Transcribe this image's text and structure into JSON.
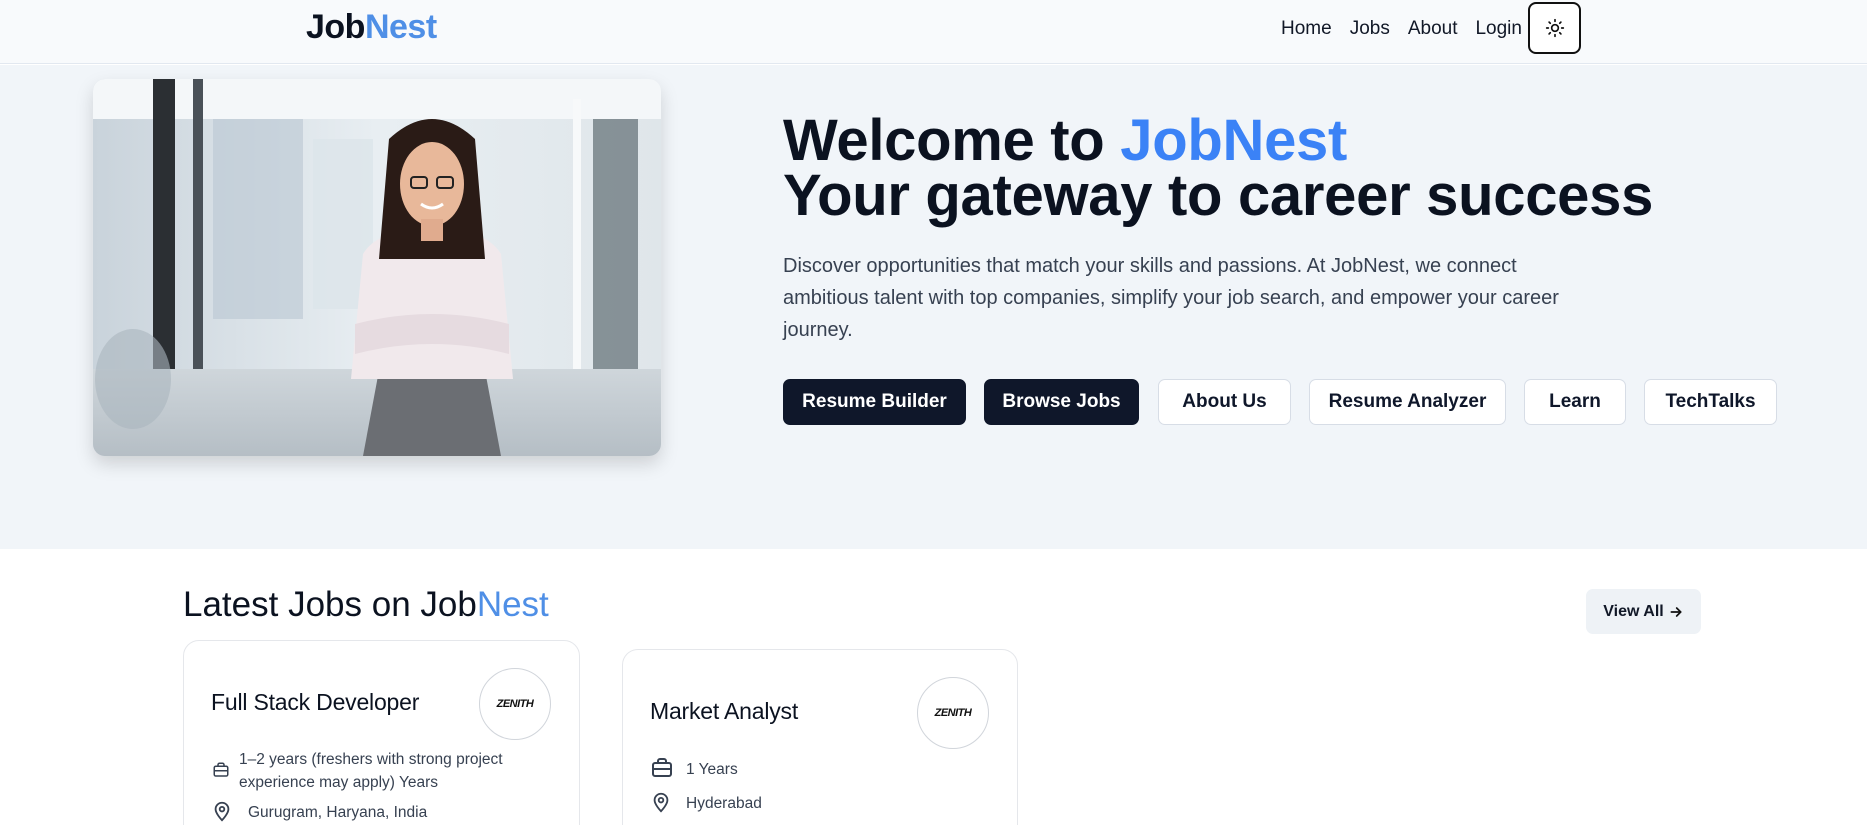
{
  "nav": {
    "logo_part1": "Job",
    "logo_part2": "Nest",
    "links": [
      "Home",
      "Jobs",
      "About",
      "Login"
    ],
    "theme_icon": "sun-icon"
  },
  "hero": {
    "title_prefix": "Welcome to ",
    "title_highlight": "JobNest",
    "title_line2": "Your gateway to career success",
    "description": "Discover opportunities that match your skills and passions. At JobNest, we connect ambitious talent with top companies, simplify your job search, and empower your career journey.",
    "buttons": [
      "Resume Builder",
      "Browse Jobs",
      "About Us",
      "Resume Analyzer",
      "Learn",
      "TechTalks"
    ]
  },
  "latest_jobs": {
    "title_prefix": "Latest Jobs on Job",
    "title_highlight": "Nest",
    "view_all_label": "View All",
    "jobs": [
      {
        "title": "Full Stack Developer",
        "company_logo_text": "ZENITH",
        "experience": "1–2 years (freshers with strong project experience may apply) Years",
        "location": "Gurugram, Haryana, India"
      },
      {
        "title": "Market Analyst",
        "company_logo_text": "ZENITH",
        "experience": "1 Years",
        "location": "Hyderabad"
      }
    ]
  },
  "colors": {
    "brand_dark": "#0f172a",
    "brand_blue": "#3b82f6",
    "logo_blue": "#4f8fe6"
  }
}
